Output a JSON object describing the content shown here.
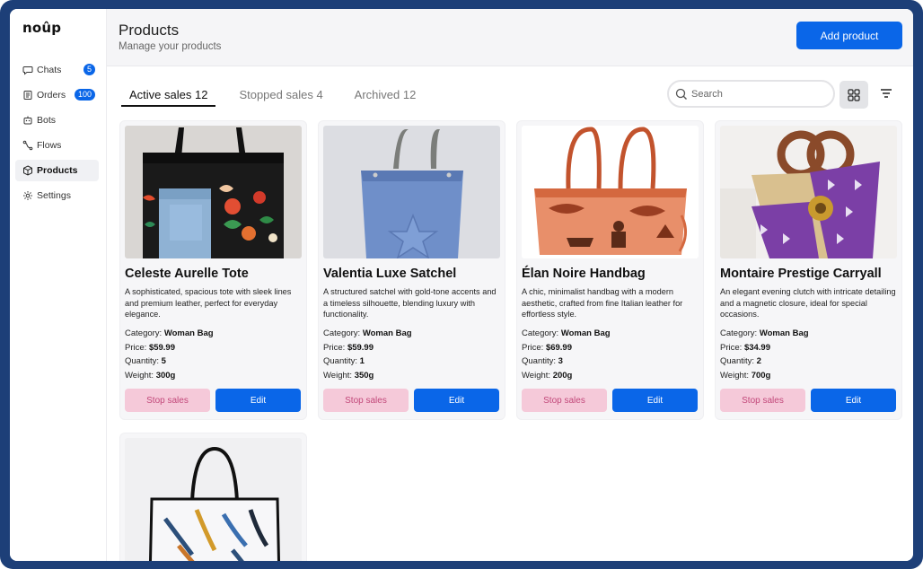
{
  "app": {
    "logo": "noûp"
  },
  "sidebar": {
    "items": [
      {
        "label": "Chats",
        "icon": "chat-icon",
        "badge": "5"
      },
      {
        "label": "Orders",
        "icon": "orders-icon",
        "badge": "100"
      },
      {
        "label": "Bots",
        "icon": "bot-icon"
      },
      {
        "label": "Flows",
        "icon": "flows-icon"
      },
      {
        "label": "Products",
        "icon": "box-icon",
        "active": true
      },
      {
        "label": "Settings",
        "icon": "gear-icon"
      }
    ]
  },
  "header": {
    "title": "Products",
    "subtitle": "Manage your products",
    "add_button": "Add product"
  },
  "tabs": [
    {
      "label": "Active sales 12",
      "active": true
    },
    {
      "label": "Stopped sales 4"
    },
    {
      "label": "Archived 12"
    }
  ],
  "search": {
    "placeholder": "Search"
  },
  "labels": {
    "category": "Category:",
    "price": "Price:",
    "quantity": "Quantity:",
    "weight": "Weight:",
    "stop_sales": "Stop sales",
    "edit": "Edit"
  },
  "products": [
    {
      "name": "Celeste Aurelle Tote",
      "description": "A sophisticated, spacious tote with sleek lines and premium leather, perfect for everyday elegance.",
      "category": "Woman Bag",
      "price": "$59.99",
      "quantity": "5",
      "weight": "300g"
    },
    {
      "name": "Valentia Luxe Satchel",
      "description": "A structured satchel with gold-tone accents and a timeless silhouette, blending luxury with functionality.",
      "category": "Woman Bag",
      "price": "$59.99",
      "quantity": "1",
      "weight": "350g"
    },
    {
      "name": "Élan Noire Handbag",
      "description": "A chic, minimalist handbag with a modern aesthetic, crafted from fine Italian leather for effortless style.",
      "category": "Woman Bag",
      "price": "$69.99",
      "quantity": "3",
      "weight": "200g"
    },
    {
      "name": "Montaire Prestige Carryall",
      "description": "An elegant evening clutch with intricate detailing and a magnetic closure, ideal for special occasions.",
      "category": "Woman Bag",
      "price": "$34.99",
      "quantity": "2",
      "weight": "700g"
    }
  ],
  "colors": {
    "accent": "#0a66e8",
    "stop_bg": "#f5c9d9",
    "stop_text": "#c2487a",
    "frame": "#1d3f78"
  }
}
